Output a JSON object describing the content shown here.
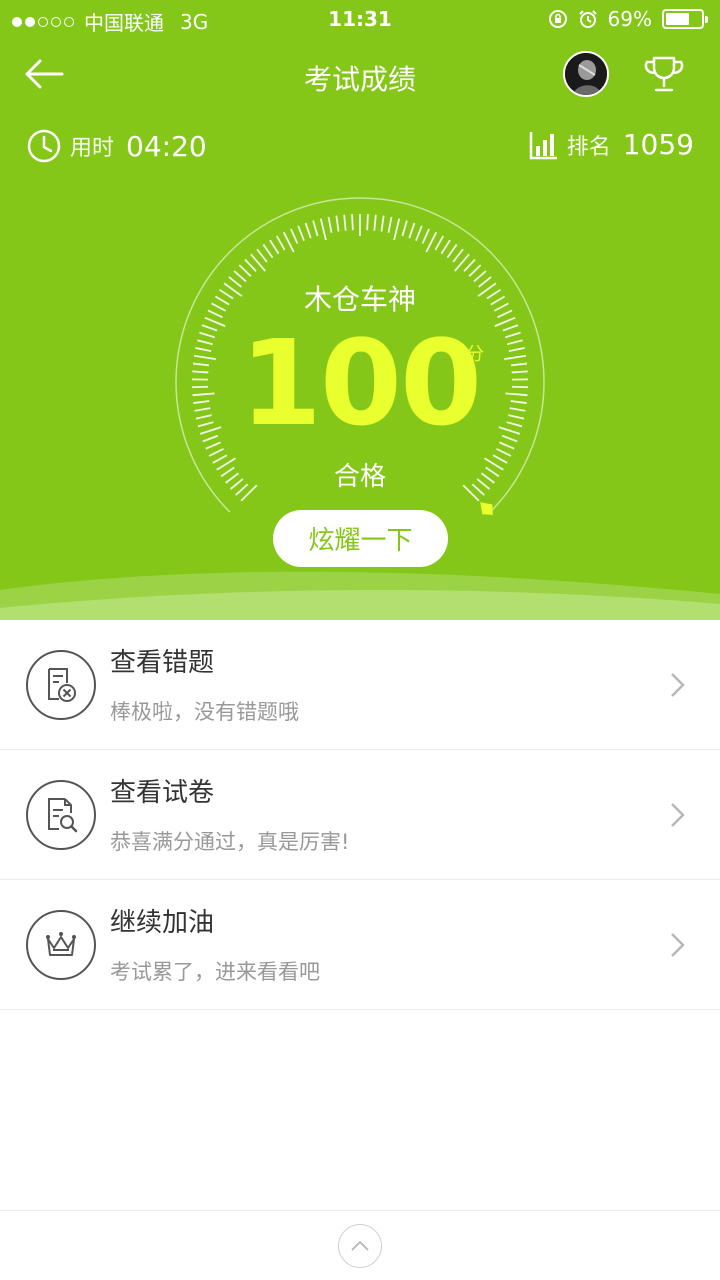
{
  "status_bar": {
    "carrier": "中国联通",
    "network": "3G",
    "time": "11:31",
    "battery": "69%",
    "battery_level": 0.69,
    "signal_strength": 2
  },
  "nav": {
    "title": "考试成绩",
    "back_icon": "arrow-left-icon",
    "trophy_icon": "trophy-icon"
  },
  "stats": {
    "time_label": "用时",
    "time_value": "04:20",
    "rank_label": "排名",
    "rank_value": "1059"
  },
  "result": {
    "title": "木仓车神",
    "score": "100",
    "unit": "分",
    "status": "合格",
    "share_label": "炫耀一下"
  },
  "list": [
    {
      "title": "查看错题",
      "subtitle": "棒极啦，没有错题哦",
      "icon": "wrong-answers-icon"
    },
    {
      "title": "查看试卷",
      "subtitle": "恭喜满分通过，真是厉害!",
      "icon": "exam-paper-search-icon"
    },
    {
      "title": "继续加油",
      "subtitle": "考试累了，进来看看吧",
      "icon": "crown-icon"
    }
  ],
  "colors": {
    "primary_green": "#84c718",
    "score_yellow": "#e9ff2e"
  }
}
